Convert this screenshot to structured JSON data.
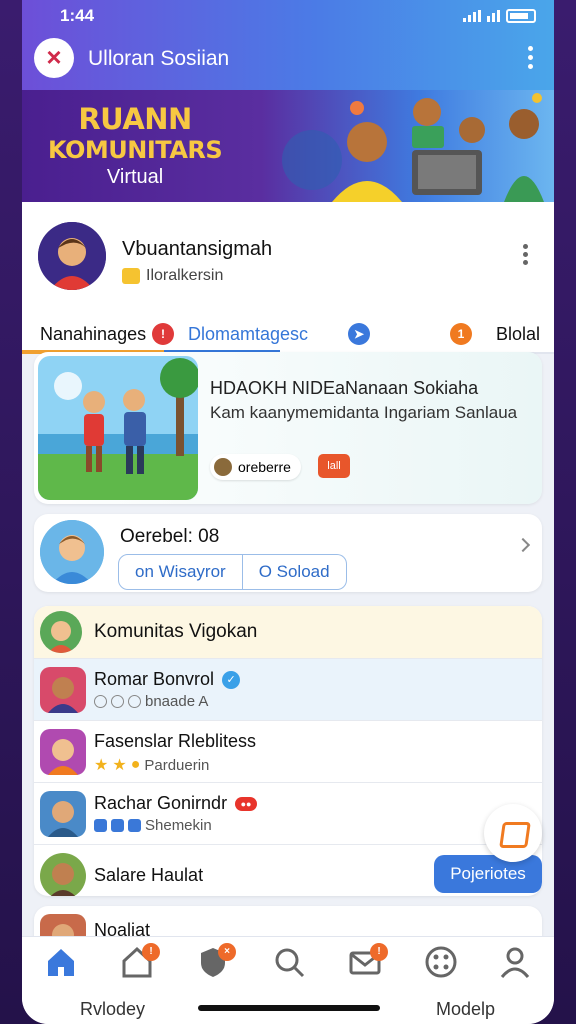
{
  "status": {
    "time": "1:44"
  },
  "header": {
    "title": "Ulloran Sosiian"
  },
  "banner": {
    "line1": "RUANN",
    "line2": "KOMUNITARS",
    "line3": "Virtual"
  },
  "profile": {
    "name": "Vbuantansigmah",
    "subtitle": "Iloralkersin"
  },
  "tabs": [
    {
      "label": "Nanahinages"
    },
    {
      "label": "Dlomamtagesc"
    },
    {
      "label": "Blolal"
    }
  ],
  "feature": {
    "title": "HDAOKH NIDEaNanaan Sokiaha",
    "text": "Kam kaanymemidanta Ingariam Sanlaua",
    "chip": "oreberre",
    "tag": "lall"
  },
  "user_card": {
    "title": "Oerebel: 08",
    "button_a": "on Wisayror",
    "button_b": "O Soload"
  },
  "list": {
    "header": "Komunitas Vigokan",
    "rows": [
      {
        "name": "Romar Bonvrol",
        "sub": "bnaade A"
      },
      {
        "name": "Fasenslar Rleblitess",
        "sub": "Parduerin"
      },
      {
        "name": "Rachar Gonirndr",
        "sub": "Shemekin"
      },
      {
        "name": "Salare Haulat",
        "button": "Pojeriotes"
      }
    ]
  },
  "partial_row": {
    "name": "Noaliat"
  },
  "nav": {
    "left_label": "Rvlodey",
    "right_label": "Modelp"
  },
  "colors": {
    "accent": "#3a78dc",
    "orange": "#f07a20",
    "purple": "#4a1f8f"
  }
}
